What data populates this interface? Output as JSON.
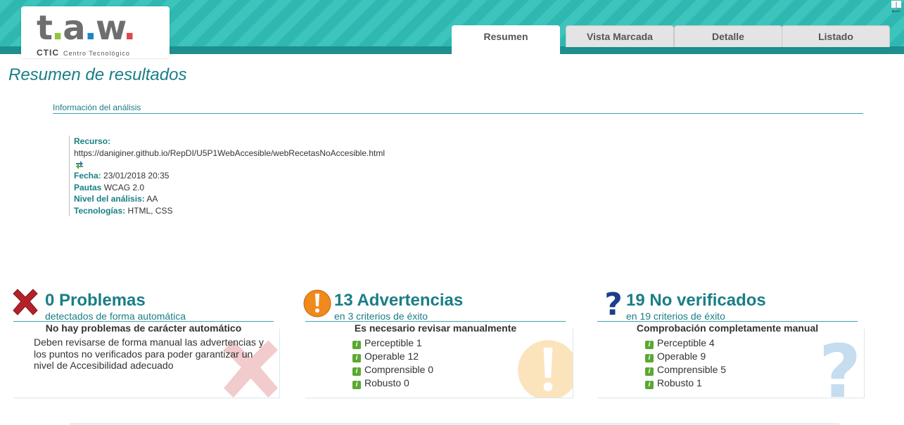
{
  "header": {
    "logo": {
      "name": "t.a.w.",
      "company": "CTIC",
      "tagline": "Centro Tecnológico"
    },
    "tabs": [
      {
        "label": "Resumen",
        "active": true
      },
      {
        "label": "Vista Marcada",
        "active": false
      },
      {
        "label": "Detalle",
        "active": false
      },
      {
        "label": "Listado",
        "active": false
      }
    ],
    "corner_icon": "collapse-icon"
  },
  "main": {
    "title": "Resumen de resultados",
    "info_section": {
      "heading": "Información del análisis",
      "recurso_label": "Recurso:",
      "recurso_url": "https://daniginer.github.io/RepDI/U5P1WebAccesible/webRecetasNoAccesible.html",
      "fecha_label": "Fecha:",
      "fecha_value": "23/01/2018 20:35",
      "pautas_label": "Pautas",
      "pautas_value": "WCAG 2.0",
      "nivel_label": "Nivel del análisis:",
      "nivel_value": "AA",
      "tecnologias_label": "Tecnologías:",
      "tecnologias_value": "HTML, CSS"
    }
  },
  "summary": {
    "problemas": {
      "count": "0 Problemas",
      "subtitle": "detectados de forma automática",
      "heading": "No hay problemas de carácter automático",
      "description": "Deben revisarse de forma manual las advertencias y los puntos no verificados para poder garantizar un nivel de Accesibilidad adecuado",
      "icon": "cross-icon"
    },
    "advertencias": {
      "count": "13 Advertencias",
      "subtitle": "en 3 criterios de éxito",
      "heading": "Es necesario revisar manualmente",
      "icon": "warning-icon",
      "items": [
        "Perceptible 1",
        "Operable 12",
        "Comprensible 0",
        "Robusto 0"
      ]
    },
    "no_verificados": {
      "count": "19 No verificados",
      "subtitle": "en 19 criterios de éxito",
      "heading": "Comprobación completamente manual",
      "icon": "question-icon",
      "items": [
        "Perceptible 4",
        "Operable 9",
        "Comprensible 5",
        "Robusto 1"
      ]
    }
  },
  "colors": {
    "accent": "#1a7e86",
    "header": "#3cc4bd",
    "header_band": "#1e8f8c",
    "warning": "#f08a1c",
    "error": "#b5212a",
    "question": "#1b3f8c"
  }
}
